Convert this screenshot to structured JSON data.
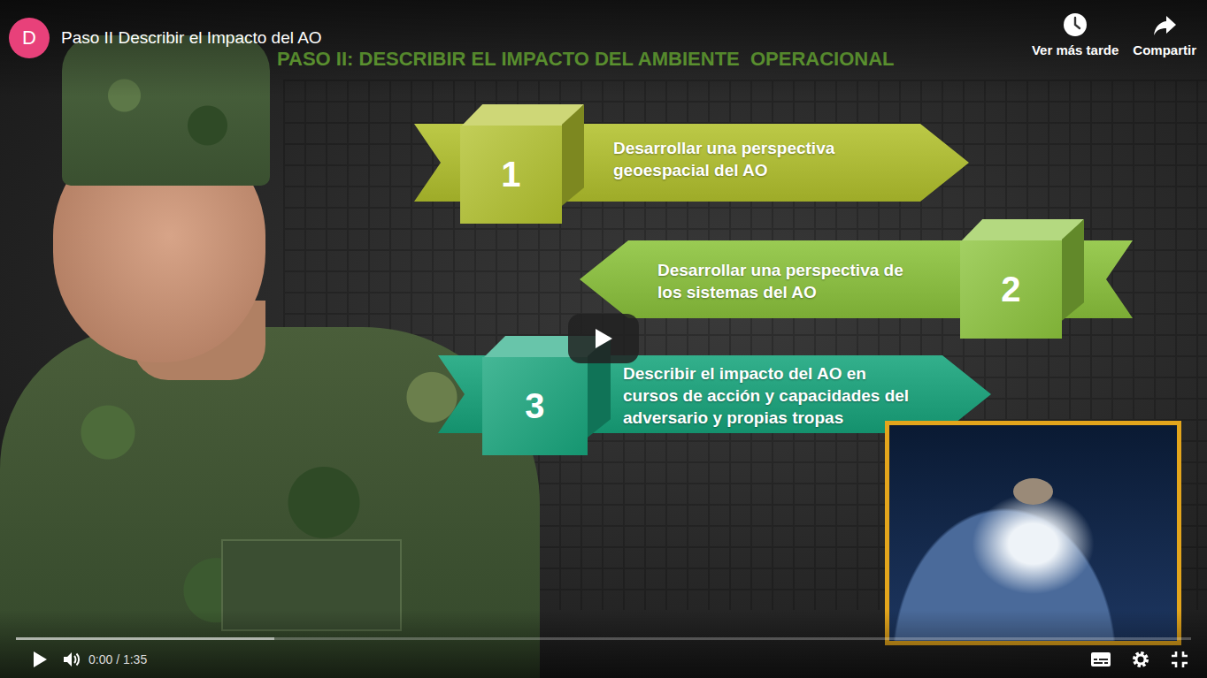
{
  "video": {
    "channel_initial": "D",
    "title": "Paso II Describir el Impacto del AO",
    "paused": true,
    "time": "0:00 / 1:35"
  },
  "progress": {
    "level": 0,
    "buffered": 0.22
  },
  "actions": [
    {
      "label": "Ver más tarde",
      "kind": "clock"
    },
    {
      "label": "Compartir",
      "kind": "share"
    }
  ],
  "slide": {
    "title": "PASO II: DESCRIBIR EL IMPACTO DEL AMBIENTE  OPERACIONAL",
    "steps": [
      {
        "number": "1",
        "lines": [
          "Desarrollar una perspectiva",
          "geoespacial del AO"
        ],
        "color": "#b3c22e",
        "kind": "right"
      },
      {
        "number": "2",
        "lines": [
          "Desarrollar una perspectiva de",
          "los sistemas del AO"
        ],
        "color": "#8cc43c",
        "kind": "left"
      },
      {
        "number": "3",
        "lines": [
          "Describir el impacto del AO en",
          "cursos de acción y capacidades del",
          "adversario y propias tropas"
        ],
        "color": "#17a57c",
        "kind": "right"
      }
    ]
  }
}
